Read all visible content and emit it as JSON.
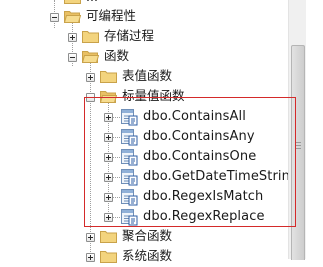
{
  "tree": {
    "partial_top_label": "...",
    "programmability": {
      "label": "可编程性",
      "expanded": true
    },
    "stored_procedures": {
      "label": "存储过程",
      "expanded": false
    },
    "functions": {
      "label": "函数",
      "expanded": true
    },
    "table_valued_functions": {
      "label": "表值函数",
      "expanded": false
    },
    "scalar_valued_functions": {
      "label": "标量值函数",
      "expanded": true
    },
    "scalar_functions": [
      {
        "label": "dbo.ContainsAll",
        "icon": "function-icon"
      },
      {
        "label": "dbo.ContainsAny",
        "icon": "function-icon"
      },
      {
        "label": "dbo.ContainsOne",
        "icon": "function-icon"
      },
      {
        "label": "dbo.GetDateTimeString",
        "icon": "function-icon"
      },
      {
        "label": "dbo.RegexIsMatch",
        "icon": "function-icon"
      },
      {
        "label": "dbo.RegexReplace",
        "icon": "function-icon"
      }
    ],
    "aggregate_functions": {
      "label": "聚合函数",
      "expanded": false
    },
    "system_functions": {
      "label": "系统函数",
      "expanded": false
    }
  },
  "colors": {
    "highlight_border": "#d42a2a",
    "folder_fill": "#f3d47e",
    "folder_border": "#c9a24a",
    "tree_lines": "#a0a0a0"
  }
}
